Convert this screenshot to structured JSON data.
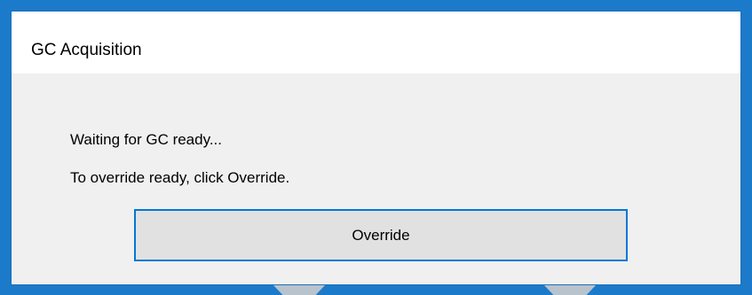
{
  "window": {
    "title": "GC Acquisition"
  },
  "message": {
    "line1": "Waiting for GC ready...",
    "line2": "To override ready, click Override."
  },
  "buttons": {
    "override_label": "Override"
  },
  "colors": {
    "backdrop": "#1c7acb",
    "dialog_body": "#f0f0f0",
    "titlebar": "#ffffff",
    "button_face": "#e1e1e1",
    "button_focus_border": "#0078d7"
  }
}
